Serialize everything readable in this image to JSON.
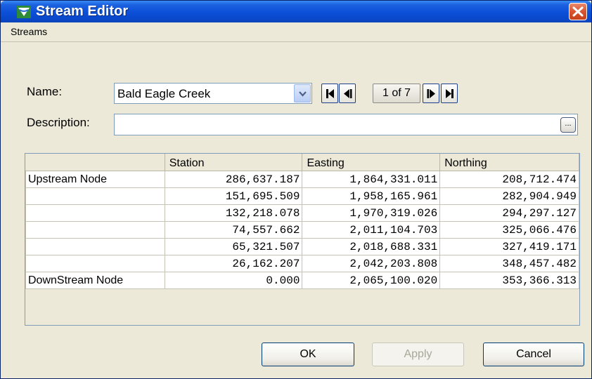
{
  "window": {
    "title": "Stream Editor"
  },
  "menu": {
    "items": [
      "Streams"
    ]
  },
  "form": {
    "name_label": "Name:",
    "name_value": "Bald Eagle Creek",
    "record_indicator": "1 of 7",
    "description_label": "Description:",
    "description_value": "",
    "browse_label": "..."
  },
  "table": {
    "headers": [
      "",
      "Station",
      "Easting",
      "Northing"
    ],
    "rows": [
      [
        "Upstream Node",
        "286,637.187",
        "1,864,331.011",
        "208,712.474"
      ],
      [
        "",
        "151,695.509",
        "1,958,165.961",
        "282,904.949"
      ],
      [
        "",
        "132,218.078",
        "1,970,319.026",
        "294,297.127"
      ],
      [
        "",
        "74,557.662",
        "2,011,104.703",
        "325,066.476"
      ],
      [
        "",
        "65,321.507",
        "2,018,688.331",
        "327,419.171"
      ],
      [
        "",
        "26,162.207",
        "2,042,203.808",
        "348,457.482"
      ],
      [
        "DownStream Node",
        "0.000",
        "2,065,100.020",
        "353,366.313"
      ]
    ]
  },
  "buttons": {
    "ok": "OK",
    "apply": "Apply",
    "cancel": "Cancel"
  },
  "icons": {
    "app": "stream-editor-icon",
    "close": "close-icon",
    "combo": "chevron-down-icon",
    "nav": [
      "first-record-icon",
      "previous-record-icon",
      "next-record-icon",
      "last-record-icon"
    ]
  },
  "colors": {
    "titlebar": "#0b4fd8",
    "close": "#d9542f",
    "window_bg": "#ece9d8"
  }
}
